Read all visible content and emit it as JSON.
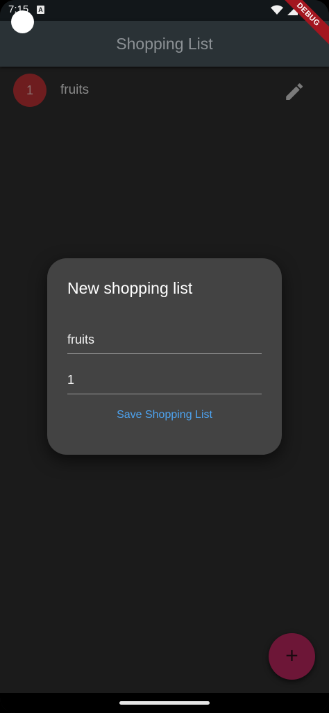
{
  "status_bar": {
    "time": "7:15",
    "notification_icon": "a-icon",
    "icons": [
      "wifi-icon",
      "signal-icon",
      "battery-icon"
    ],
    "debug_label": "DEBUG"
  },
  "app_bar": {
    "title": "Shopping List"
  },
  "list": {
    "items": [
      {
        "priority": "1",
        "name": "fruits",
        "action_icon": "edit-icon"
      }
    ]
  },
  "dialog": {
    "title": "New shopping list",
    "name_value": "fruits",
    "priority_value": "1",
    "save_label": "Save Shopping List"
  },
  "fab": {
    "label": "+",
    "icon": "add-icon"
  },
  "colors": {
    "background": "#1b1b1b",
    "app_bar": "#2a3236",
    "dialog": "#434343",
    "avatar": "#6e1d1f",
    "fab": "#6d1637",
    "accent_link": "#4da3f0",
    "debug_banner": "#a3161f"
  }
}
